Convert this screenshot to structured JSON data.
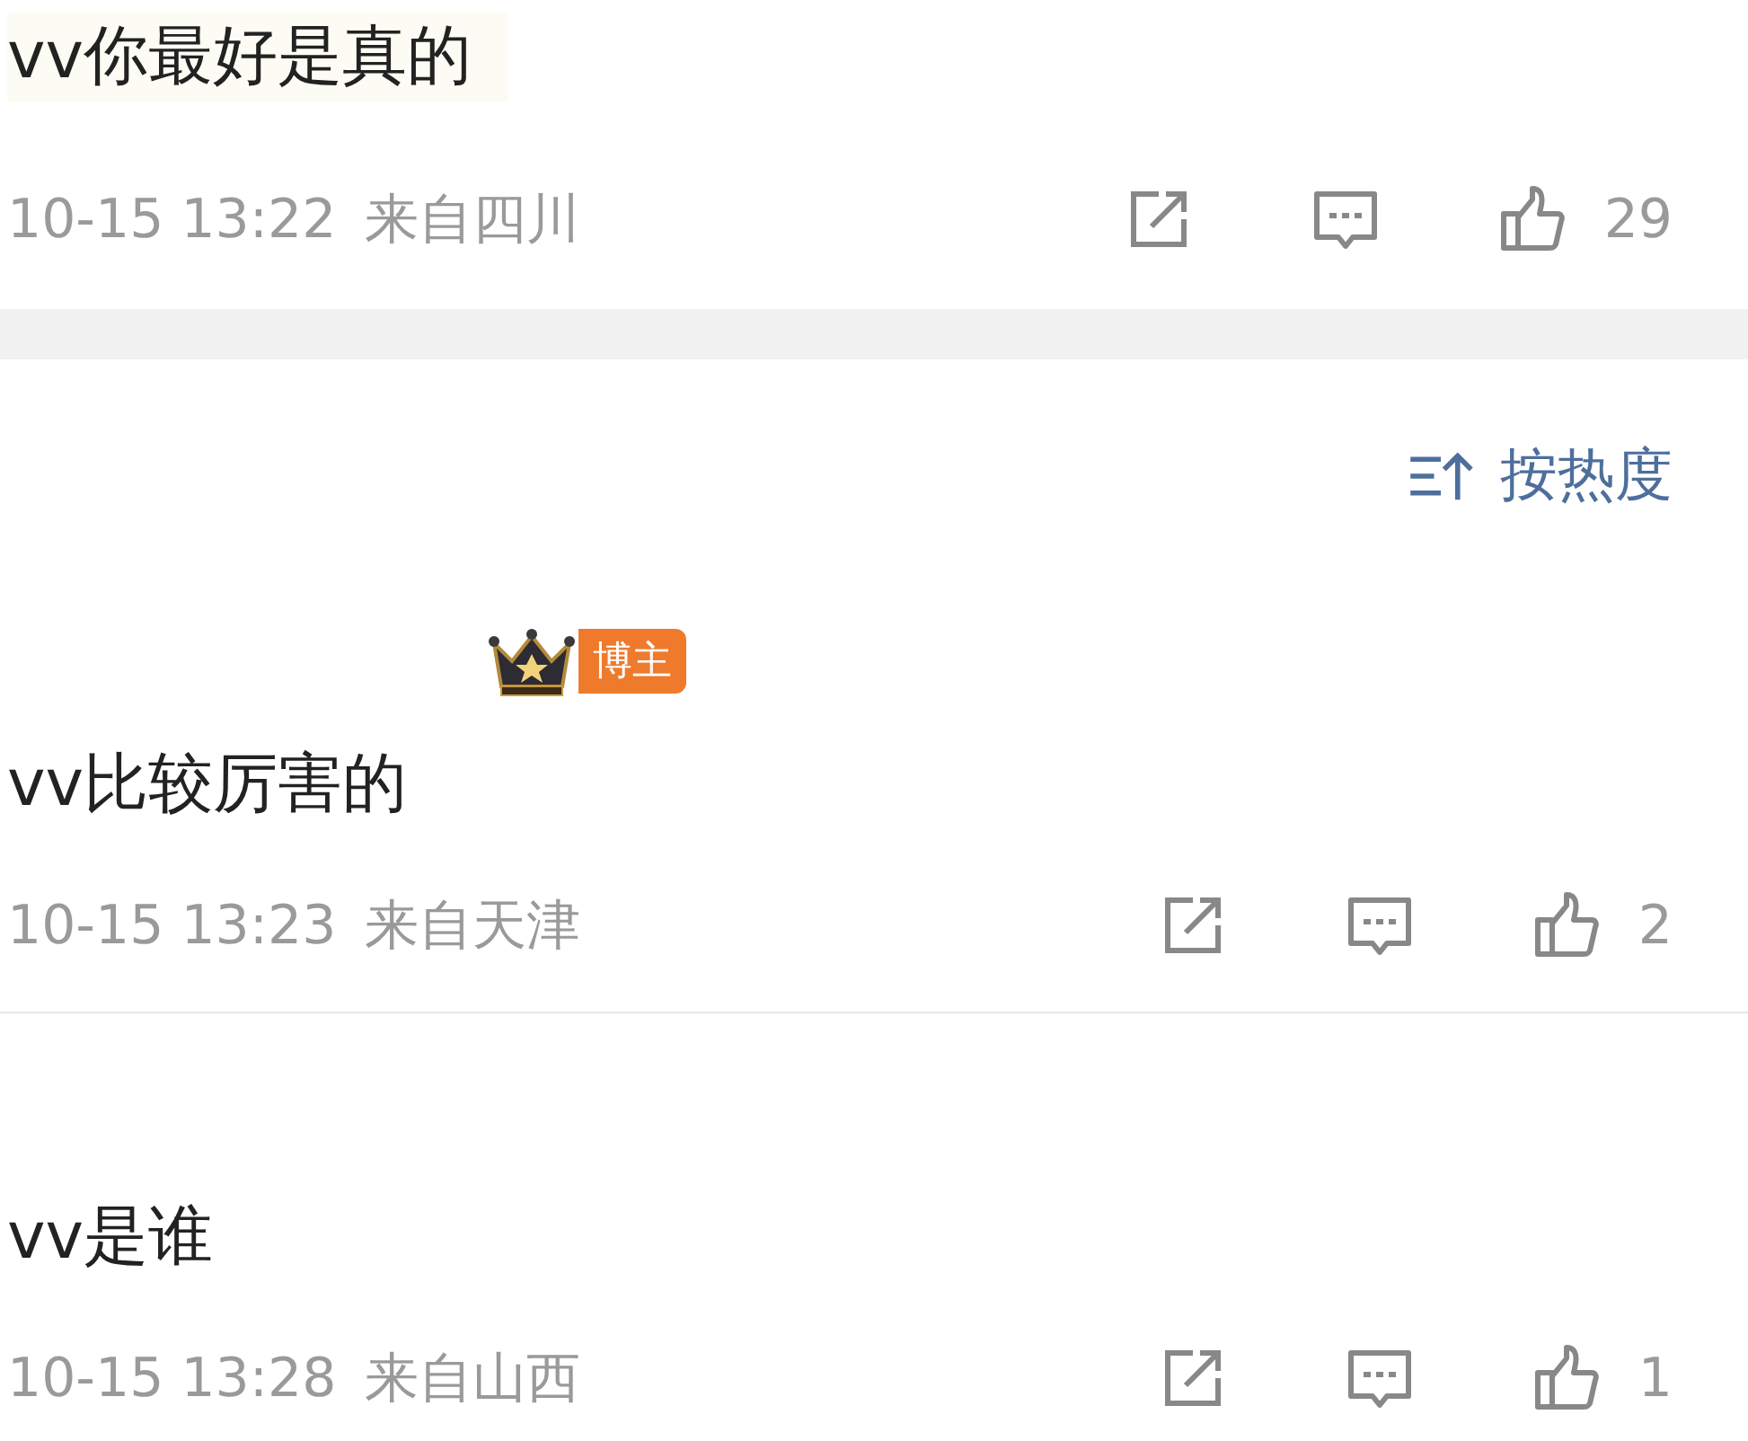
{
  "comments": [
    {
      "text": "vv你最好是真的",
      "time": "10-15 13:22",
      "location": "来自四川",
      "likes": "29"
    },
    {
      "badge": "博主",
      "text": "vv比较厉害的",
      "time": "10-15 13:23",
      "location": "来自天津",
      "likes": "2"
    },
    {
      "text": "vv是谁",
      "time": "10-15 13:28",
      "location": "来自山西",
      "likes": "1"
    }
  ],
  "sort": {
    "label": "按热度"
  }
}
